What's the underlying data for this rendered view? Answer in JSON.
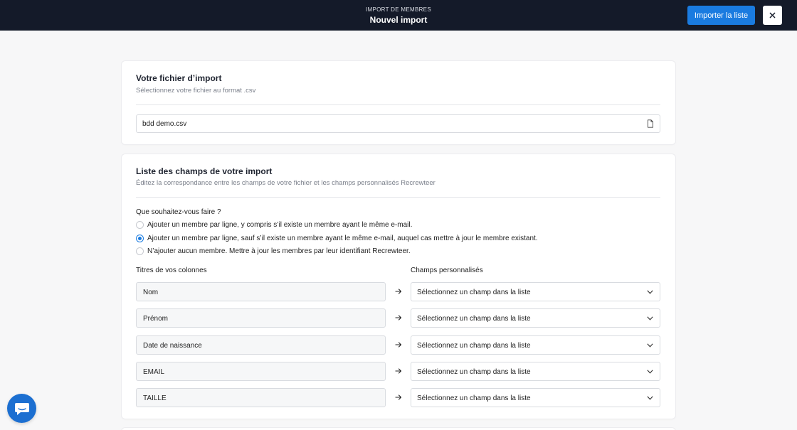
{
  "header": {
    "kicker": "IMPORT DE MEMBRES",
    "title": "Nouvel import",
    "import_button": "Importer la liste",
    "close_icon": "close-icon"
  },
  "file_card": {
    "title": "Votre fichier d’import",
    "subtitle": "Sélectionnez votre fichier au format .csv",
    "file_value": "bdd demo.csv",
    "file_icon": "file-icon"
  },
  "fields_card": {
    "title": "Liste des champs de votre import",
    "subtitle": "Éditez la correspondance entre les champs de votre fichier et les champs personnalisés Recrewteer",
    "question": "Que souhaitez-vous faire ?",
    "options": [
      {
        "label": "Ajouter un membre par ligne, y compris s’il existe un membre ayant le même e-mail.",
        "checked": false
      },
      {
        "label": "Ajouter un membre par ligne, sauf s’il existe un membre ayant le même e-mail, auquel cas mettre à jour le membre existant.",
        "checked": true
      },
      {
        "label": "N’ajouter aucun membre. Mettre à jour les membres par leur identifiant Recrewteer.",
        "checked": false
      }
    ],
    "col_source": "Titres de vos colonnes",
    "col_target": "Champs personnalisés",
    "rows": [
      {
        "source": "Nom",
        "target": "Sélectionnez un champ dans la liste"
      },
      {
        "source": "Prénom",
        "target": "Sélectionnez un champ dans la liste"
      },
      {
        "source": "Date de naissance",
        "target": "Sélectionnez un champ dans la liste"
      },
      {
        "source": "EMAIL",
        "target": "Sélectionnez un champ dans la liste"
      },
      {
        "source": "TAILLE",
        "target": "Sélectionnez un champ dans la liste"
      }
    ]
  },
  "chat_widget": {
    "icon": "chat-icon"
  },
  "colors": {
    "topbar": "#141a29",
    "accent": "#1a7be0",
    "background": "#f7f7f8"
  }
}
